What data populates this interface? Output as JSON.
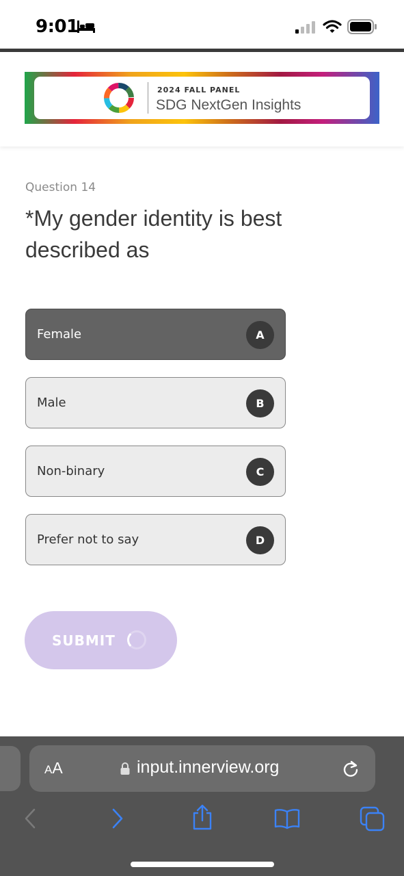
{
  "status_bar": {
    "time": "9:01",
    "icons": [
      "bed-icon",
      "cellular-signal-icon",
      "wifi-icon",
      "battery-icon"
    ]
  },
  "banner": {
    "panel": "2024 FALL PANEL",
    "title": "SDG NextGen Insights"
  },
  "question": {
    "number": "Question 14",
    "title": "*My gender identity is best described as"
  },
  "options": [
    {
      "label": "Female",
      "key": "A",
      "selected": true
    },
    {
      "label": "Male",
      "key": "B",
      "selected": false
    },
    {
      "label": "Non-binary",
      "key": "C",
      "selected": false
    },
    {
      "label": "Prefer not to say",
      "key": "D",
      "selected": false
    }
  ],
  "submit": {
    "label": "SUBMIT"
  },
  "browser": {
    "aa_small": "A",
    "aa_big": "A",
    "url": "input.innerview.org",
    "toolbar_icons": [
      "back-icon",
      "forward-icon",
      "share-icon",
      "bookmarks-icon",
      "tabs-icon"
    ]
  },
  "colors": {
    "selected_option": "#636363",
    "option_bg": "#ececec",
    "submit_bg": "#d4c7eb",
    "browser_bar": "#535353",
    "accent_blue": "#3b82f6"
  }
}
